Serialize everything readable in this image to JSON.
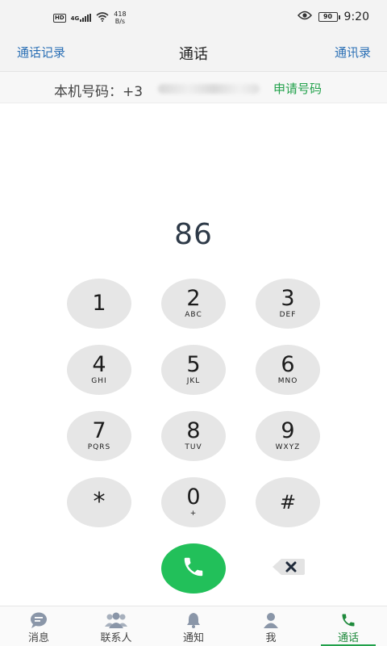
{
  "status_bar": {
    "hd": "HD",
    "network": "4G",
    "speed_value": "418",
    "speed_unit": "B/s",
    "battery": "90",
    "time": "9:20"
  },
  "nav": {
    "left": "通话记录",
    "title": "通话",
    "right": "通讯录"
  },
  "number_bar": {
    "label": "本机号码：",
    "value_visible": "+3",
    "apply": "申请号码"
  },
  "dialer": {
    "display": "86",
    "keys": [
      {
        "digit": "1",
        "letters": ""
      },
      {
        "digit": "2",
        "letters": "ABC"
      },
      {
        "digit": "3",
        "letters": "DEF"
      },
      {
        "digit": "4",
        "letters": "GHI"
      },
      {
        "digit": "5",
        "letters": "JKL"
      },
      {
        "digit": "6",
        "letters": "MNO"
      },
      {
        "digit": "7",
        "letters": "PQRS"
      },
      {
        "digit": "8",
        "letters": "TUV"
      },
      {
        "digit": "9",
        "letters": "WXYZ"
      },
      {
        "digit": "*",
        "letters": ""
      },
      {
        "digit": "0",
        "letters": "+"
      },
      {
        "digit": "#",
        "letters": ""
      }
    ]
  },
  "tabs": [
    {
      "label": "消息",
      "icon": "message-icon"
    },
    {
      "label": "联系人",
      "icon": "contacts-icon"
    },
    {
      "label": "通知",
      "icon": "bell-icon"
    },
    {
      "label": "我",
      "icon": "profile-icon"
    },
    {
      "label": "通话",
      "icon": "phone-icon",
      "active": true
    }
  ],
  "colors": {
    "accent_green": "#22c05a",
    "link_blue": "#2a6fb5",
    "active_tab": "#1f8a3c"
  }
}
